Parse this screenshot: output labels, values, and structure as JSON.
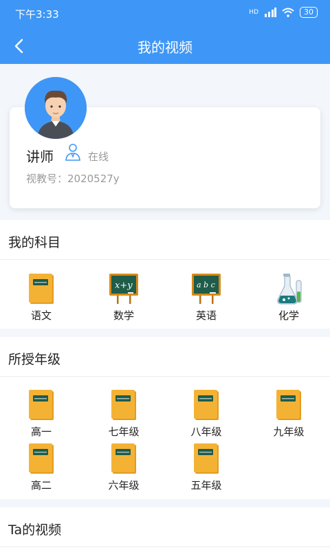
{
  "status_bar": {
    "time": "下午3:33",
    "network": "HD",
    "battery": "30"
  },
  "header": {
    "title": "我的视频"
  },
  "profile": {
    "name": "讲师",
    "status": "在线",
    "view_id": "视教号：2020527y"
  },
  "subjects": {
    "title": "我的科目",
    "items": [
      {
        "label": "语文",
        "icon": "book-icon"
      },
      {
        "label": "数学",
        "icon": "math-board-icon"
      },
      {
        "label": "英语",
        "icon": "english-board-icon"
      },
      {
        "label": "化学",
        "icon": "chemistry-flask-icon"
      }
    ]
  },
  "grades": {
    "title": "所授年级",
    "items": [
      {
        "label": "高一",
        "icon": "book-icon"
      },
      {
        "label": "七年级",
        "icon": "book-icon"
      },
      {
        "label": "八年级",
        "icon": "book-icon"
      },
      {
        "label": "九年级",
        "icon": "book-icon"
      },
      {
        "label": "高二",
        "icon": "book-icon"
      },
      {
        "label": "六年级",
        "icon": "book-icon"
      },
      {
        "label": "五年级",
        "icon": "book-icon"
      }
    ]
  },
  "videos": {
    "title": "Ta的视频"
  },
  "colors": {
    "primary": "#3e97f6",
    "book": "#f4b235",
    "board": "#1f5c4a"
  }
}
